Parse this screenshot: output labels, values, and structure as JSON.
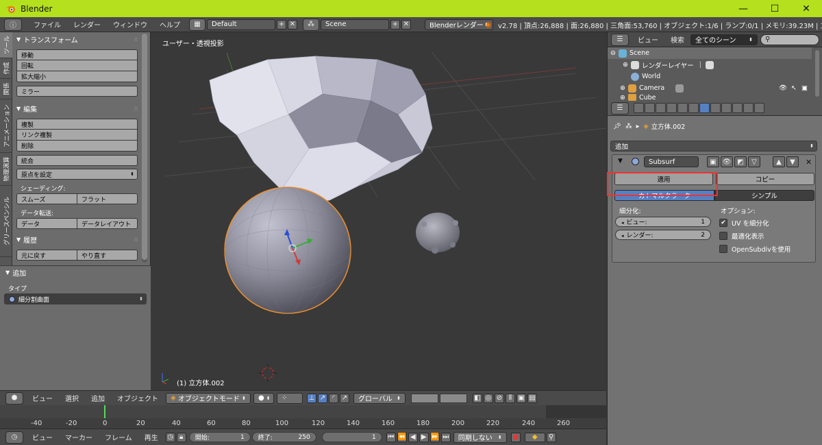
{
  "window": {
    "title": "Blender",
    "minimize": "—",
    "maximize": "☐",
    "close": "✕"
  },
  "info": {
    "info_icon": "ⓘ",
    "menus": [
      "ファイル",
      "レンダー",
      "ウィンドウ",
      "ヘルプ"
    ],
    "layout_name": "Default",
    "scene_name": "Scene",
    "engine": "Blenderレンダー",
    "stats": "v2.78 | 頂点:26,888 | 面:26,880 | 三角面:53,760 | オブジェクト:1/6 | ランプ:0/1 | メモリ:39.23M | 立方体.0"
  },
  "tool_shelf": {
    "tabs": [
      "ツール",
      "作成",
      "関係",
      "アニメーション",
      "物理演算",
      "グリースペンシル"
    ],
    "transform": {
      "header": "トランスフォーム",
      "buttons": [
        "移動",
        "回転",
        "拡大縮小"
      ],
      "mirror": "ミラー"
    },
    "edit": {
      "header": "編集",
      "buttons": [
        "複製",
        "リンク複製",
        "削除"
      ],
      "join": "統合",
      "origin": "原点を設定"
    },
    "shading": {
      "label": "シェーディング:",
      "smooth": "スムーズ",
      "flat": "フラット"
    },
    "data_transfer": {
      "label": "データ転送:",
      "data": "データ",
      "layout": "データレイアウト"
    },
    "history": {
      "header": "履歴",
      "undo": "元に戻す",
      "redo": "やり直す"
    }
  },
  "operator": {
    "header": "追加",
    "type_label": "タイプ",
    "type_value": "細分割曲面"
  },
  "viewport": {
    "title": "ユーザー・透視投影",
    "object_label": "(1) 立方体.002"
  },
  "view3d_header": {
    "menus": [
      "ビュー",
      "選択",
      "追加",
      "オブジェクト"
    ],
    "mode": "オブジェクトモード",
    "orientation": "グローバル"
  },
  "timeline": {
    "ticks": [
      "-40",
      "-20",
      "0",
      "20",
      "40",
      "60",
      "80",
      "100",
      "120",
      "140",
      "160",
      "180",
      "200",
      "220",
      "240",
      "260"
    ],
    "menus": [
      "ビュー",
      "マーカー",
      "フレーム",
      "再生"
    ],
    "start_label": "開始:",
    "start_value": "1",
    "end_label": "終了:",
    "end_value": "250",
    "current": "1",
    "sync": "同期しない"
  },
  "outliner": {
    "view_label": "ビュー",
    "search_label": "検索",
    "filter": "全てのシーン",
    "rows": [
      "Scene",
      "レンダーレイヤー",
      "World",
      "Camera",
      "Cube"
    ]
  },
  "properties": {
    "breadcrumb": "立方体.002",
    "add_modifier": "追加",
    "modifier_name": "Subsurf",
    "apply": "適用",
    "copy": "コピー",
    "catmull": "カトマルクラーク",
    "simple": "シンプル",
    "subdiv_label": "細分化:",
    "view_label": "ビュー:",
    "view_value": "1",
    "render_label": "レンダー:",
    "render_value": "2",
    "options_label": "オプション:",
    "uv_subdiv": "UV を細分化",
    "optimal": "最適化表示",
    "opensubdiv": "OpenSubdivを使用"
  },
  "colors": {
    "titlebar": "#b4e01e",
    "active_blue": "#5680c2",
    "highlight": "#e33333"
  }
}
